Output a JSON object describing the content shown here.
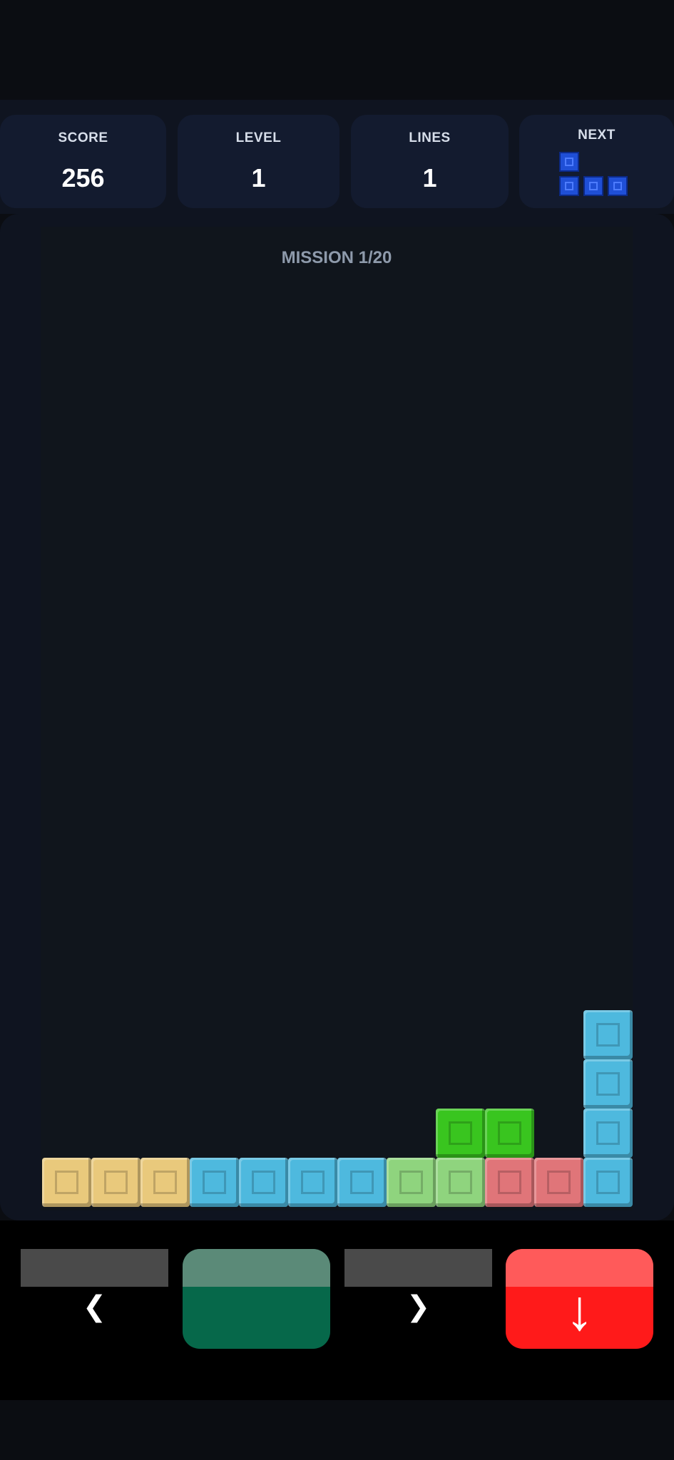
{
  "hud": {
    "score_label": "SCORE",
    "score_value": "256",
    "level_label": "LEVEL",
    "level_value": "1",
    "lines_label": "LINES",
    "lines_value": "1",
    "next_label": "NEXT",
    "next_piece": "J-tetromino",
    "next_piece_color": "#1f4fd6"
  },
  "board": {
    "mission": "MISSION 1/20",
    "background": "#10151c",
    "columns": 12,
    "blocks": [
      {
        "color": "yellow",
        "col": 0,
        "row": 0
      },
      {
        "color": "yellow",
        "col": 1,
        "row": 0
      },
      {
        "color": "yellow",
        "col": 2,
        "row": 0
      },
      {
        "color": "cyan",
        "col": 3,
        "row": 0
      },
      {
        "color": "cyan",
        "col": 4,
        "row": 0
      },
      {
        "color": "cyan",
        "col": 5,
        "row": 0
      },
      {
        "color": "cyan",
        "col": 6,
        "row": 0
      },
      {
        "color": "lightgreen",
        "col": 7,
        "row": 0
      },
      {
        "color": "lightgreen",
        "col": 8,
        "row": 0
      },
      {
        "color": "red",
        "col": 9,
        "row": 0
      },
      {
        "color": "red",
        "col": 10,
        "row": 0
      },
      {
        "color": "cyan",
        "col": 11,
        "row": 0
      },
      {
        "color": "green",
        "col": 8,
        "row": 1
      },
      {
        "color": "green",
        "col": 9,
        "row": 1
      },
      {
        "color": "cyan",
        "col": 11,
        "row": 1
      },
      {
        "color": "cyan",
        "col": 11,
        "row": 2
      },
      {
        "color": "cyan",
        "col": 11,
        "row": 3
      }
    ]
  },
  "colors": {
    "yellow": "#e9c97c",
    "cyan": "#4eb9de",
    "lightgreen": "#8fd47e",
    "green": "#39c51f",
    "red": "#e07579",
    "rotate_button": "#06684a",
    "drop_button": "#ff1a1a",
    "move_button": "#4a4a4a"
  },
  "controls": {
    "left_glyph": "❮",
    "right_glyph": "❯",
    "drop_glyph": "↓"
  }
}
